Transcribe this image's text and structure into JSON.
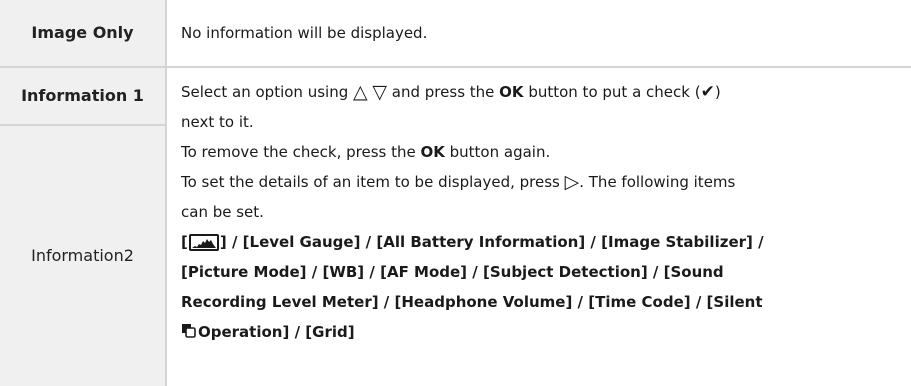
{
  "rows": [
    {
      "label": "Image Only",
      "description": "No information will be displayed."
    },
    {
      "label": "Information 1"
    },
    {
      "label_line1": "Information",
      "label_line2": "2"
    }
  ],
  "shared": {
    "line1_a": "Select an option using ",
    "up_symbol": "△",
    "down_symbol": "▽",
    "line1_b": " and press the ",
    "ok_label": "OK",
    "line1_c": " button to put a check (",
    "check_symbol": "✔",
    "line1_d": ")",
    "line2": "next to it.",
    "line3_a": "To remove the check, press the ",
    "line3_ok": "OK",
    "line3_b": " button again.",
    "line4_a": "To set the details of an item to be displayed, press ",
    "right_symbol": "▷",
    "line4_b": ". The following items",
    "line5": "can be set.",
    "items": {
      "histogram_open": "[",
      "histogram_close": "]",
      "sep": " / ",
      "level_gauge": "[Level Gauge]",
      "all_battery": "[All Battery Information]",
      "image_stabilizer": "[Image Stabilizer]",
      "picture_mode": "[Picture Mode]",
      "wb": "[WB]",
      "af_mode": "[AF Mode]",
      "subject_detection": "[Subject Detection]",
      "sound_part1": "[Sound",
      "sound_part2": "Recording Level Meter]",
      "headphone_volume": "[Headphone Volume]",
      "time_code": "[Time Code]",
      "silent_part1": "[Silent",
      "silent_part2": "Operation]",
      "grid": "[Grid]"
    }
  },
  "icons": {
    "histogram": "histogram-icon",
    "silent": "silent-mode-icon"
  },
  "colors": {
    "label_bg": "#f0f0f0",
    "separator": "#d4d4d4",
    "text": "#1a1a1a"
  }
}
